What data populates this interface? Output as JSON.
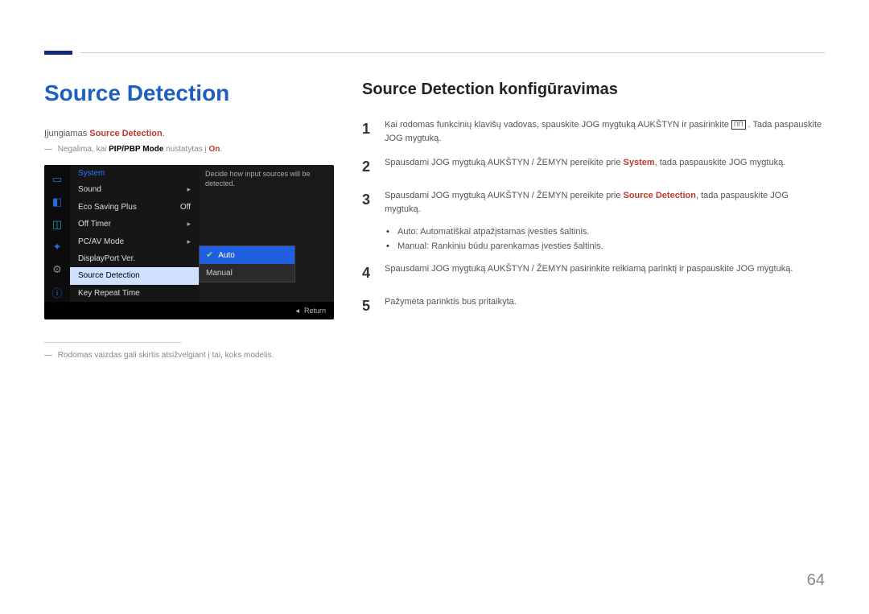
{
  "page_number": "64",
  "left": {
    "title": "Source Detection",
    "intro_prefix": "Įjungiamas ",
    "intro_em": "Source Detection",
    "intro_suffix": ".",
    "note_prefix": "Negalima, kai ",
    "note_em": "PIP/PBP Mode",
    "note_mid": " nustatytas į ",
    "note_em2": "On",
    "note_suffix": ".",
    "footnote": "Rodomas vaizdas gali skirtis atsižvelgiant į tai, koks modelis."
  },
  "osd": {
    "section_title": "System",
    "items": [
      {
        "label": "Sound",
        "value": "▸"
      },
      {
        "label": "Eco Saving Plus",
        "value": "Off"
      },
      {
        "label": "Off Timer",
        "value": "▸"
      },
      {
        "label": "PC/AV Mode",
        "value": "▸"
      },
      {
        "label": "DisplayPort Ver.",
        "value": ""
      },
      {
        "label": "Source Detection",
        "value": ""
      },
      {
        "label": "Key Repeat Time",
        "value": ""
      }
    ],
    "description": "Decide how input sources will be detected.",
    "popup": {
      "items": [
        {
          "label": "Auto",
          "selected": true
        },
        {
          "label": "Manual",
          "selected": false
        }
      ]
    },
    "return_label": "Return"
  },
  "right": {
    "title": "Source Detection konfigūravimas",
    "steps": {
      "s1a": "Kai rodomas funkcinių klavišų vadovas, spauskite JOG mygtuką AUKŠTYN ir pasirinkite ",
      "s1b": ". Tada paspauskite JOG mygtuką.",
      "s2a": "Spausdami JOG mygtuką AUKŠTYN / ŽEMYN pereikite prie ",
      "s2_em": "System",
      "s2b": ", tada paspauskite JOG mygtuką.",
      "s3a": "Spausdami JOG mygtuką AUKŠTYN / ŽEMYN pereikite prie ",
      "s3_em": "Source Detection",
      "s3b": ", tada paspauskite JOG mygtuką.",
      "bullet_auto_em": "Auto",
      "bullet_auto": ": Automatiškai atpažįstamas įvesties šaltinis.",
      "bullet_manual_em": "Manual",
      "bullet_manual": ": Rankiniu būdu parenkamas įvesties šaltinis.",
      "s4": "Spausdami JOG mygtuką AUKŠTYN / ŽEMYN pasirinkite reikiamą parinktį ir paspauskite JOG mygtuką.",
      "s5": "Pažymėta parinktis bus pritaikyta."
    }
  }
}
